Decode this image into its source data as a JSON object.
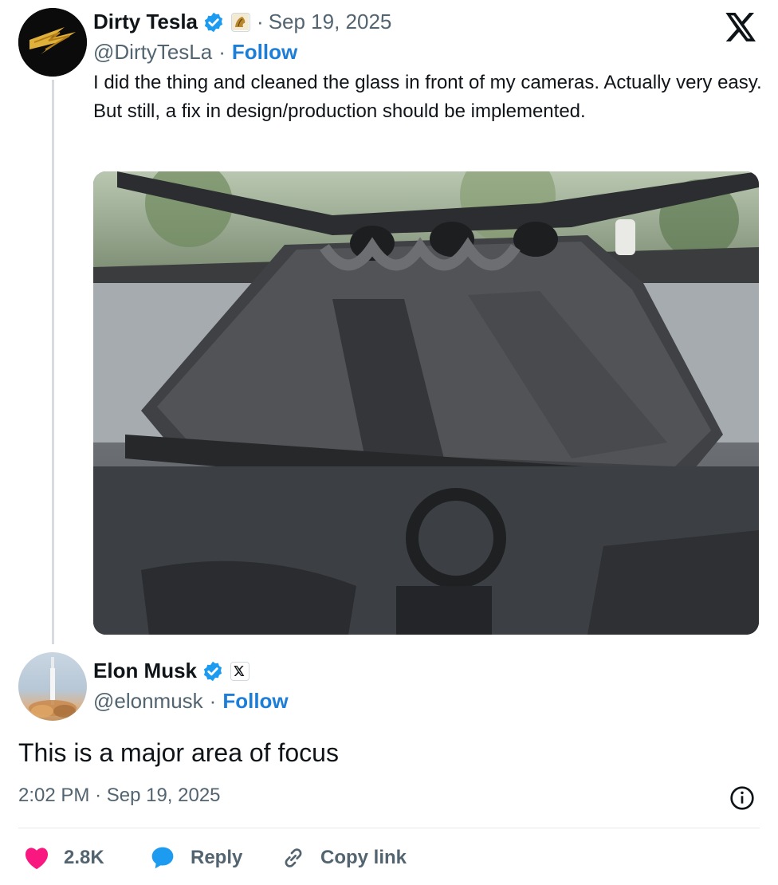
{
  "quoted_post": {
    "author_name": "Dirty Tesla",
    "verified": true,
    "separator": "·",
    "date": "Sep 19, 2025",
    "handle": "@DirtyTesLa",
    "follow_label": "Follow",
    "text": "I did the thing and cleaned the glass in front of my cameras. Actually very easy. But still, a fix in design/production should be implemented.",
    "media": "photo"
  },
  "brand": {
    "icon": "x-logo-icon"
  },
  "reply_post": {
    "author_name": "Elon Musk",
    "verified": true,
    "handle": "@elonmusk",
    "separator": "·",
    "follow_label": "Follow",
    "text": "This is a major area of focus",
    "time": "2:02 PM",
    "date": "Sep 19, 2025"
  },
  "actions": {
    "likes": "2.8K",
    "reply_label": "Reply",
    "copy_link_label": "Copy link"
  },
  "colors": {
    "text": "#0f1419",
    "secondary": "#536471",
    "link": "#1d7ed8",
    "verified": "#1d9bf0",
    "like": "#f91880"
  }
}
